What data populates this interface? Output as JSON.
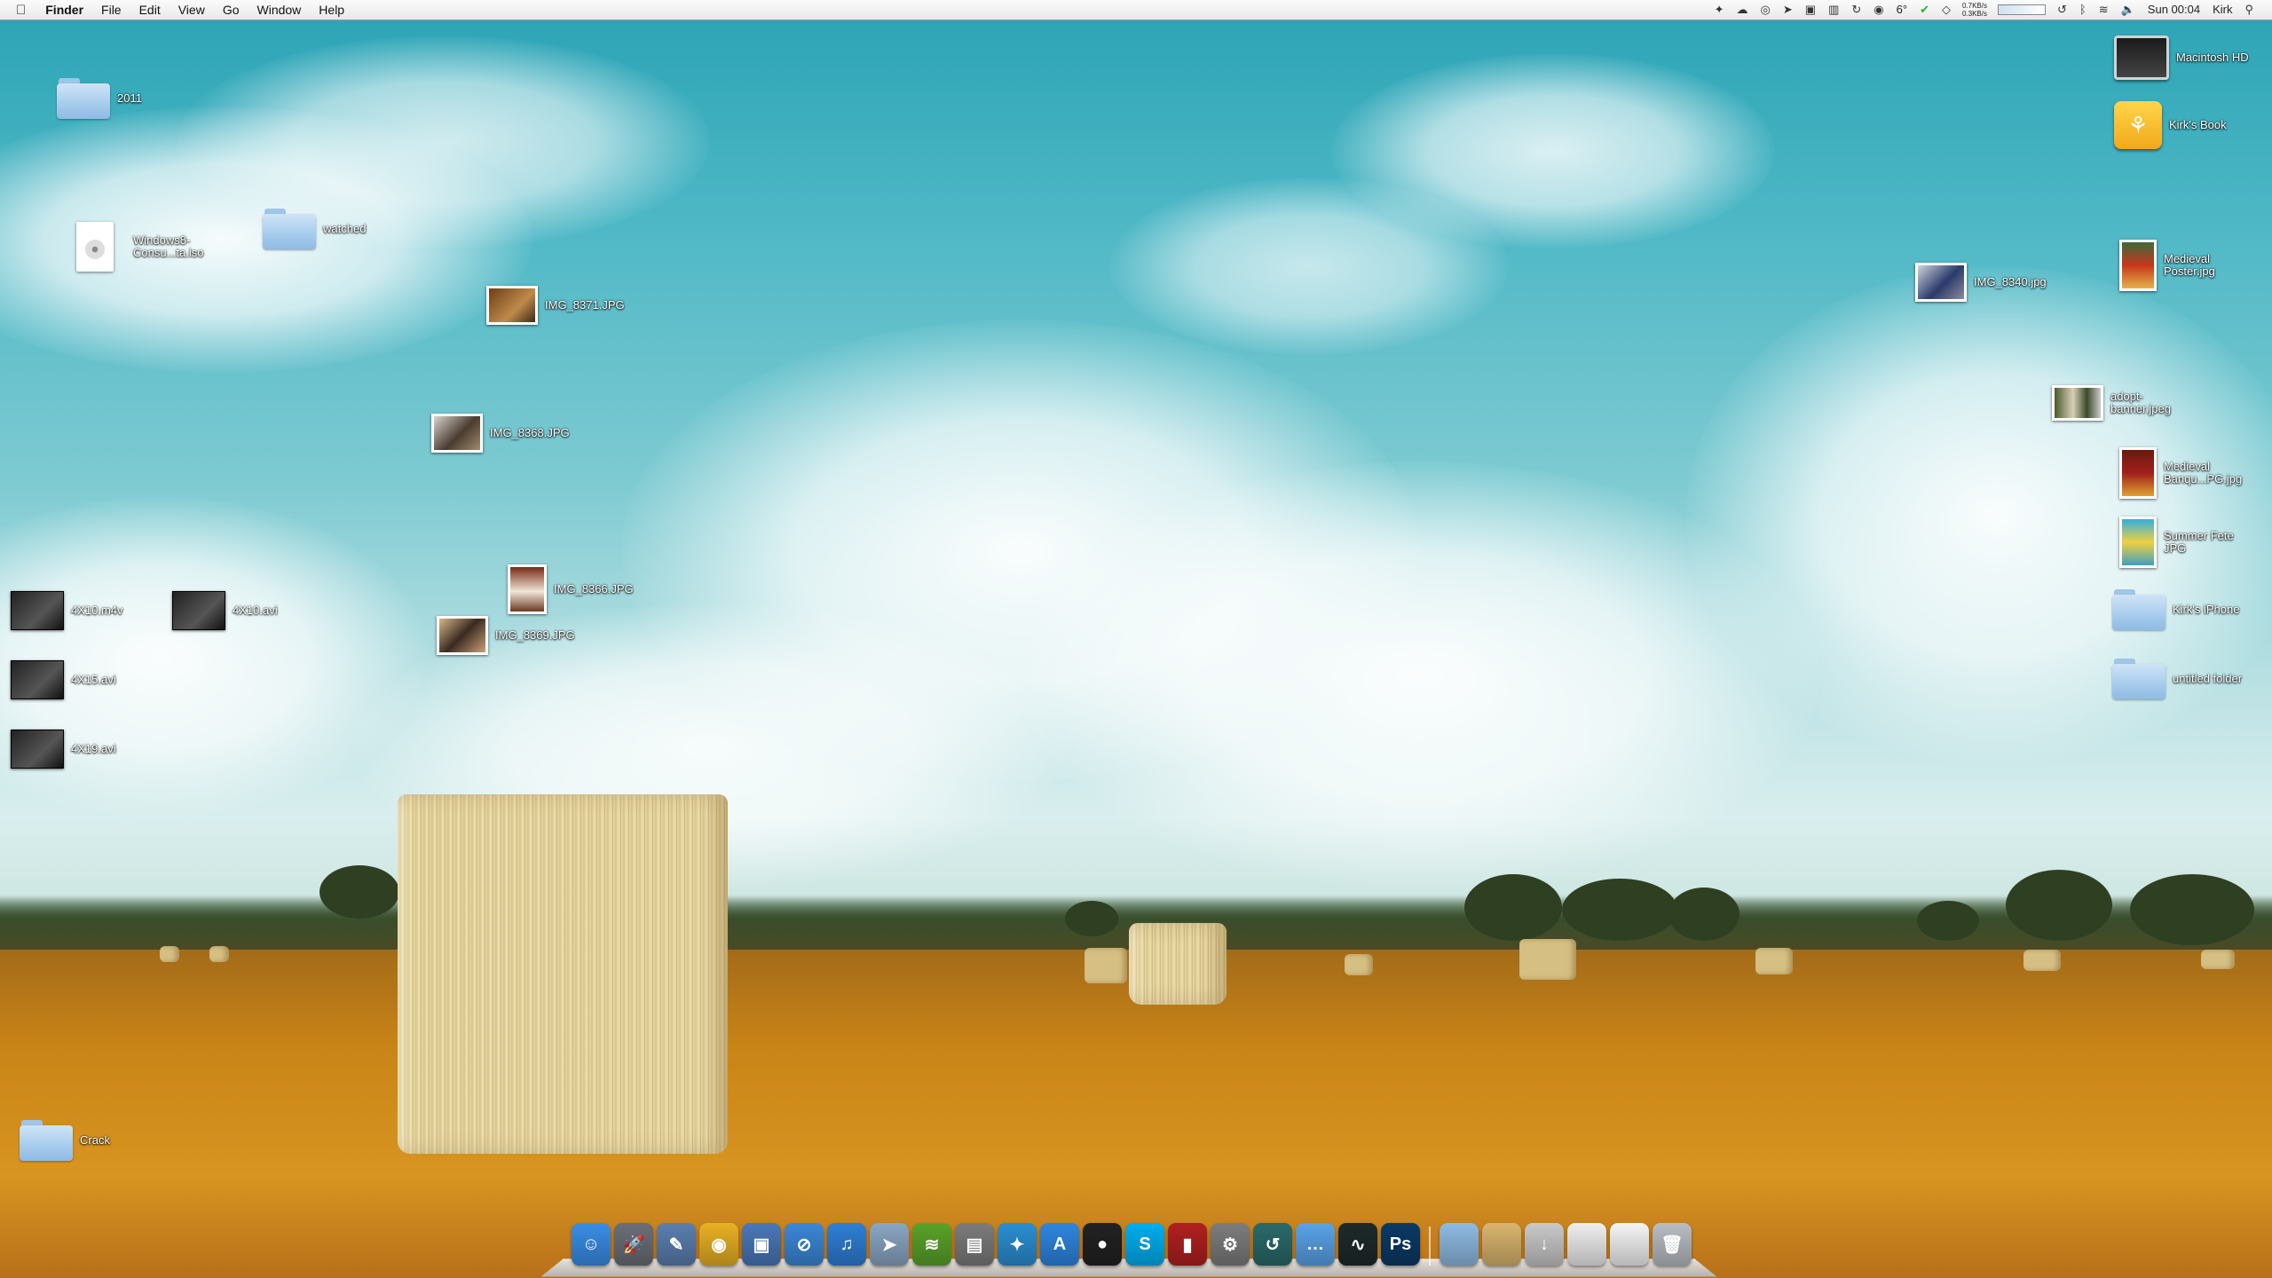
{
  "menubar": {
    "apple": "",
    "app_name": "Finder",
    "menus": [
      "File",
      "Edit",
      "View",
      "Go",
      "Window",
      "Help"
    ],
    "temperature": "6°",
    "net_up": "0.7KB/s",
    "net_down": "0.3KB/s",
    "clock": "Sun 00:04",
    "user": "Kirk"
  },
  "desktop": {
    "folder_2011": "2011",
    "windows_iso": "Windows8-\nConsu...ta.iso",
    "folder_watched": "watched",
    "img_8371": "IMG_8371.JPG",
    "img_8368": "IMG_8368.JPG",
    "img_8366": "IMG_8366.JPG",
    "img_8369": "IMG_8369.JPG",
    "m4v_4x10": "4X10.m4v",
    "avi_4x10": "4X10.avi",
    "avi_4x15": "4X15.avi",
    "avi_4x19": "4X19.avi",
    "folder_crack": "Crack",
    "macintosh_hd": "Macintosh HD",
    "kirks_book": "Kirk's Book",
    "medieval_poster": "Medieval\nPoster.jpg",
    "img_8340": "IMG_8340.jpg",
    "adopt_banner": "adopt-\nbanner.jpeg",
    "medieval_banquet": "Medieval\nBanqu...PG.jpg",
    "summer_fete": "Summer Fete\nJPG",
    "kirks_iphone": "Kirk's iPhone",
    "untitled_folder": "untitled folder"
  },
  "dock": {
    "items": [
      {
        "icon": "finder-icon",
        "color": "#3a8ee6",
        "glyph": "☺"
      },
      {
        "icon": "launchpad-icon",
        "color": "#6b6f78",
        "glyph": "🚀"
      },
      {
        "icon": "preview-icon",
        "color": "#5b7fb0",
        "glyph": "✎"
      },
      {
        "icon": "chrome-icon",
        "color": "#e8b124",
        "glyph": "◉"
      },
      {
        "icon": "iphoto-icon",
        "color": "#4a78b8",
        "glyph": "▣"
      },
      {
        "icon": "safari-icon",
        "color": "#3b88d8",
        "glyph": "⊘"
      },
      {
        "icon": "itunes-icon",
        "color": "#2f7fd6",
        "glyph": "♫"
      },
      {
        "icon": "mail-icon",
        "color": "#8aa6c4",
        "glyph": "➤"
      },
      {
        "icon": "spotify-icon",
        "color": "#5aa32a",
        "glyph": "≋"
      },
      {
        "icon": "photo-booth-icon",
        "color": "#7c7c7c",
        "glyph": "▤"
      },
      {
        "icon": "twitter-icon",
        "color": "#2b8fd3",
        "glyph": "✦"
      },
      {
        "icon": "app-store-icon",
        "color": "#2e86e0",
        "glyph": "A"
      },
      {
        "icon": "dvd-player-icon",
        "color": "#222222",
        "glyph": "●"
      },
      {
        "icon": "skype-icon",
        "color": "#00aff0",
        "glyph": "S"
      },
      {
        "icon": "photo-slideshow-icon",
        "color": "#b02020",
        "glyph": "▮"
      },
      {
        "icon": "system-preferences-icon",
        "color": "#7d7d7d",
        "glyph": "⚙"
      },
      {
        "icon": "time-machine-icon",
        "color": "#2a6a6a",
        "glyph": "↺"
      },
      {
        "icon": "messages-icon",
        "color": "#5aa3e8",
        "glyph": "…"
      },
      {
        "icon": "activity-monitor-icon",
        "color": "#1e2a2a",
        "glyph": "∿"
      },
      {
        "icon": "photoshop-icon",
        "color": "#0b3a66",
        "glyph": "Ps"
      }
    ],
    "stacks": [
      {
        "icon": "applications-folder-icon",
        "color": "#8fbbe3",
        "glyph": ""
      },
      {
        "icon": "documents-stack-icon",
        "color": "#d9b56f",
        "glyph": ""
      },
      {
        "icon": "downloads-stack-icon",
        "color": "#c9c9c9",
        "glyph": "↓"
      },
      {
        "icon": "screenshots-stack-icon",
        "color": "#efefef",
        "glyph": ""
      },
      {
        "icon": "files-stack-icon",
        "color": "#f5f5f5",
        "glyph": ""
      },
      {
        "icon": "trash-icon",
        "color": "#b9bec4",
        "glyph": "🗑"
      }
    ]
  }
}
